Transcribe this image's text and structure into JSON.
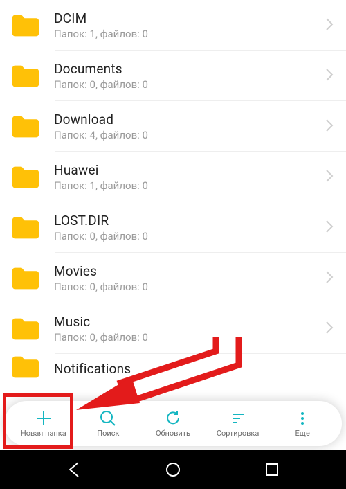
{
  "folders": [
    {
      "name": "DCIM",
      "meta": "Папок: 1, файлов: 0"
    },
    {
      "name": "Documents",
      "meta": "Папок: 0, файлов: 0"
    },
    {
      "name": "Download",
      "meta": "Папок: 4, файлов: 0"
    },
    {
      "name": "Huawei",
      "meta": "Папок: 1, файлов: 0"
    },
    {
      "name": "LOST.DIR",
      "meta": "Папок: 0, файлов: 0"
    },
    {
      "name": "Movies",
      "meta": "Папок: 0, файлов: 0"
    },
    {
      "name": "Music",
      "meta": "Папок: 0, файлов: 0"
    },
    {
      "name": "Notifications",
      "meta": ""
    }
  ],
  "toolbar": {
    "new_folder": "Новая папка",
    "search": "Поиск",
    "refresh": "Обновить",
    "sort": "Сортировка",
    "more": "Еще"
  },
  "colors": {
    "accent": "#14b6c1",
    "folder": "#ffc107",
    "annotation": "#e31b1b"
  }
}
